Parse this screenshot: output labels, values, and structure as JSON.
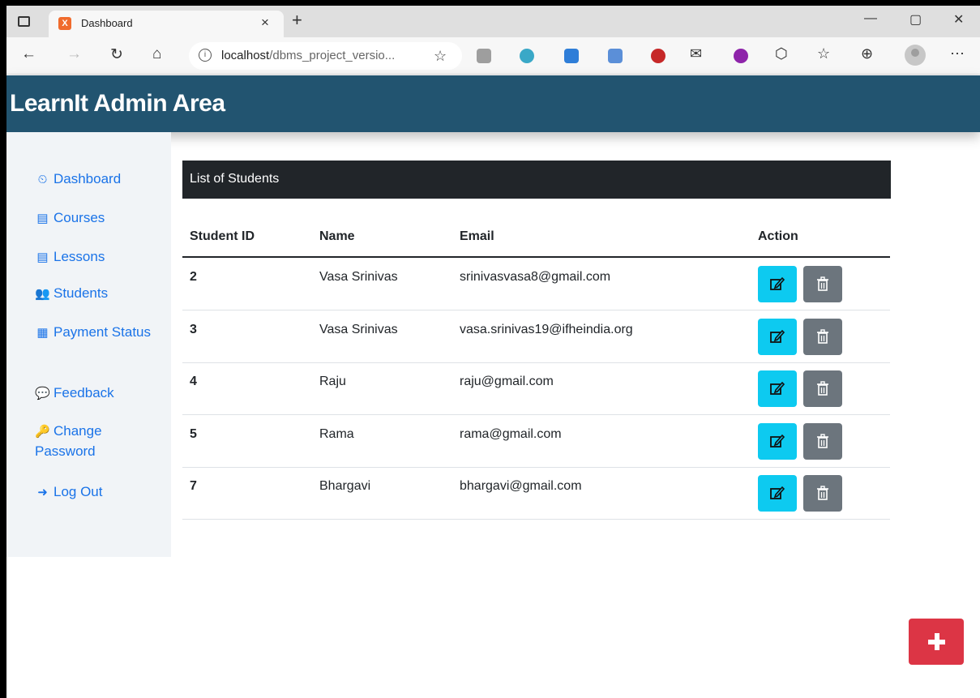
{
  "browser": {
    "tab_title": "Dashboard",
    "tab_close": "×",
    "new_tab": "+",
    "url_host": "localhost",
    "url_path": "/dbms_project_versio...",
    "min": "—",
    "restore": "▢",
    "close": "✕"
  },
  "header": {
    "brand": "LearnIt Admin Area"
  },
  "sidebar": {
    "items": [
      {
        "icon": "tachometer-icon",
        "glyph": "⏲",
        "label": "Dashboard"
      },
      {
        "icon": "book-icon",
        "glyph": "▤",
        "label": "Courses"
      },
      {
        "icon": "book-icon",
        "glyph": "▤",
        "label": "Lessons"
      },
      {
        "icon": "users-icon",
        "glyph": "👥",
        "label": "Students"
      },
      {
        "icon": "table-icon",
        "glyph": "▦",
        "label": "Payment Status"
      },
      {
        "icon": "comments-icon",
        "glyph": "💬",
        "label": "Feedback"
      },
      {
        "icon": "key-icon",
        "glyph": "🔑",
        "label": "Change Password"
      },
      {
        "icon": "sign-out-icon",
        "glyph": "➜",
        "label": "Log Out"
      }
    ]
  },
  "main": {
    "card_title": "List of Students",
    "columns": [
      "Student ID",
      "Name",
      "Email",
      "Action"
    ],
    "rows": [
      {
        "id": "2",
        "name": "Vasa Srinivas",
        "email": "srinivasvasa8@gmail.com"
      },
      {
        "id": "3",
        "name": "Vasa Srinivas",
        "email": "vasa.srinivas19@ifheindia.org"
      },
      {
        "id": "4",
        "name": "Raju",
        "email": "raju@gmail.com"
      },
      {
        "id": "5",
        "name": "Rama",
        "email": "rama@gmail.com"
      },
      {
        "id": "7",
        "name": "Bhargavi",
        "email": "bhargavi@gmail.com"
      }
    ]
  },
  "colors": {
    "topbar": "#225470",
    "link": "#1a73e8",
    "edit": "#0dcaf0",
    "delete": "#6c757d",
    "add": "#dc3545"
  }
}
